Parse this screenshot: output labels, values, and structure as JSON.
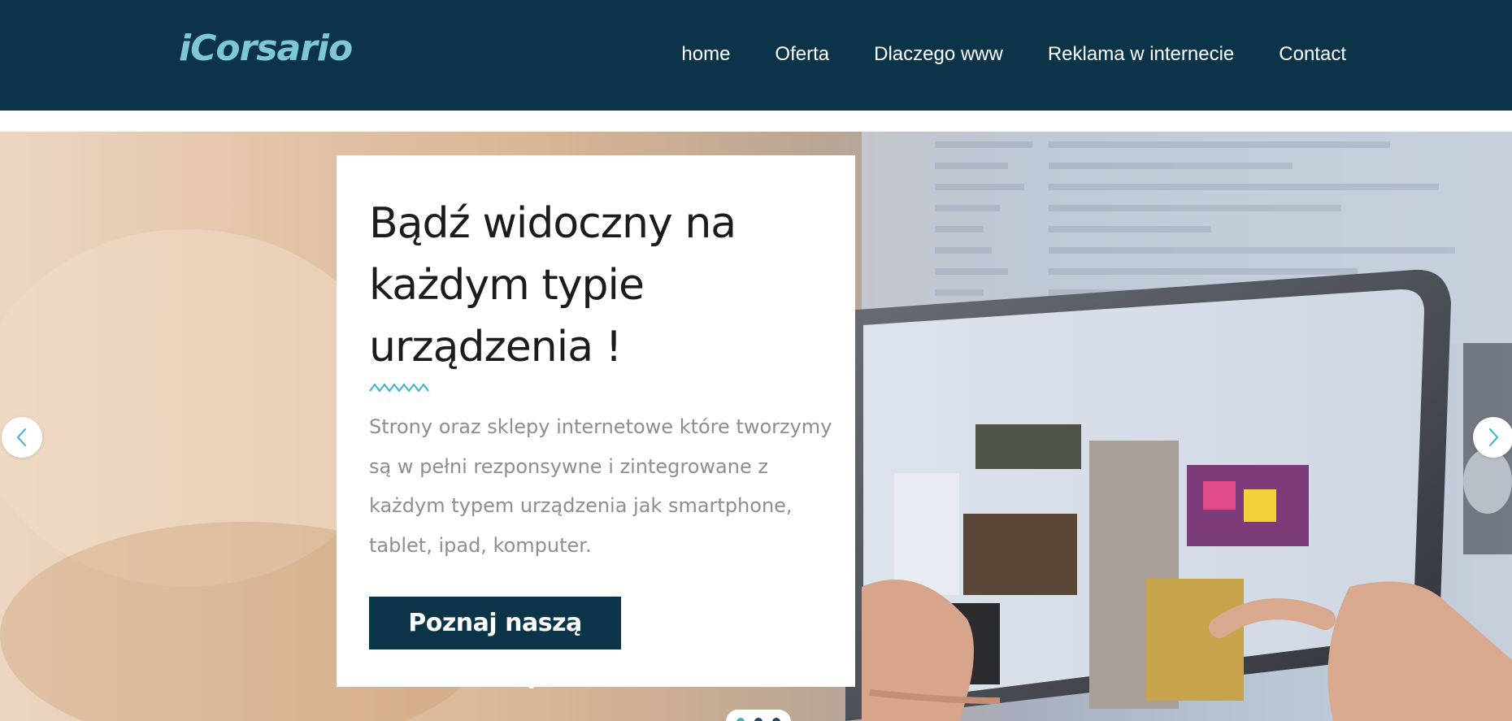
{
  "brand": {
    "logo_text": "iCorsario",
    "logo_color": "#7ec8d3"
  },
  "nav": {
    "items": [
      {
        "label": "home"
      },
      {
        "label": "Oferta"
      },
      {
        "label": "Dlaczego www"
      },
      {
        "label": "Reklama w internecie"
      },
      {
        "label": "Contact"
      }
    ],
    "background": "#0c3448"
  },
  "hero": {
    "background_image": "hands holding a tablet displaying an online store",
    "card": {
      "title": "Bądź widoczny na każdym typie urządzenia !",
      "text": "Strony oraz sklepy internetowe które tworzymy są w pełni rezponsywne i zintegrowane z każdym typem urządzenia jak smartphone, tablet, ipad, komputer.",
      "button_label": "Poznaj naszą ofertę",
      "accent_color": "#3ab3c9"
    },
    "slider": {
      "prev_icon": "chevron-left-icon",
      "next_icon": "chevron-right-icon",
      "slide_count": 3,
      "active_slide": 1
    }
  }
}
